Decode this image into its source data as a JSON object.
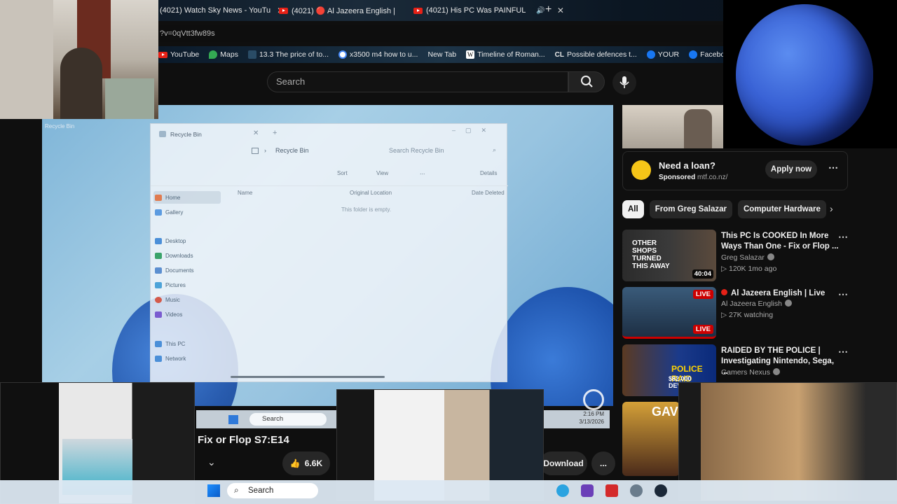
{
  "tabs": [
    {
      "label": "(4021) Watch Sky News - YouTu"
    },
    {
      "label": "(4021) 🔴 Al Jazeera English |"
    },
    {
      "label": "(4021) His PC Was PAINFUL"
    }
  ],
  "url": "?v=0qVtt3fw89s",
  "bookmarks": [
    "YouTube",
    "Maps",
    "13.3 The price of to...",
    "x3500 m4 how to u...",
    "New Tab",
    "Timeline of Roman...",
    "Possible defences t...",
    "YOUR",
    "Facebook gr"
  ],
  "search": {
    "placeholder": "Search"
  },
  "video": {
    "window_title": "Recycle Bin",
    "breadcrumb": "Recycle Bin",
    "search_placeholder": "Search Recycle Bin",
    "toolbar": {
      "sort": "Sort",
      "view": "View",
      "details": "Details",
      "more": "..."
    },
    "sidebar": [
      "Home",
      "Gallery",
      "Desktop",
      "Downloads",
      "Documents",
      "Pictures",
      "Music",
      "Videos",
      "This PC",
      "Network"
    ],
    "columns": [
      "Name",
      "Original Location",
      "Date Deleted"
    ],
    "empty_text": "This folder is empty.",
    "taskbar_search": "Search",
    "clock_time": "2:16 PM",
    "clock_date": "3/13/2026",
    "desktop_icon_label": "Recycle Bin"
  },
  "title": "Fix or Flop S7:E14",
  "actions": {
    "likes": "6.6K",
    "download": "Download",
    "more": "..."
  },
  "ad": {
    "headline": "Need a loan?",
    "sponsored": "Sponsored",
    "domain": "mtf.co.nz/",
    "cta": "Apply now"
  },
  "chips": [
    "All",
    "From Greg Salazar",
    "Computer Hardware"
  ],
  "recommendations": [
    {
      "title": "This PC Is COOKED In More Ways Than One - Fix or Flop ...",
      "channel": "Greg Salazar",
      "meta": "120K  1mo ago",
      "duration": "40:04",
      "thumb_text": "OTHER SHOPS TURNED THIS AWAY"
    },
    {
      "title": "Al Jazeera English | Live",
      "channel": "Al Jazeera English",
      "meta": "27K watching",
      "duration": "LIVE",
      "badge_top": "LIVE"
    },
    {
      "title": "RAIDED BY THE POLICE | Investigating Nintendo, Sega, ...",
      "channel": "Gamers Nexus",
      "thumb_text": "POLICE RAID",
      "thumb_sub": "$82,000 DEVKITS"
    }
  ],
  "desktop_taskbar": {
    "search": "Search"
  },
  "colors": {
    "yt_red": "#ff0000",
    "bg": "#0f0f0f",
    "chip_active": "#f1f1f1",
    "accent_blue": "#3ea6ff"
  }
}
